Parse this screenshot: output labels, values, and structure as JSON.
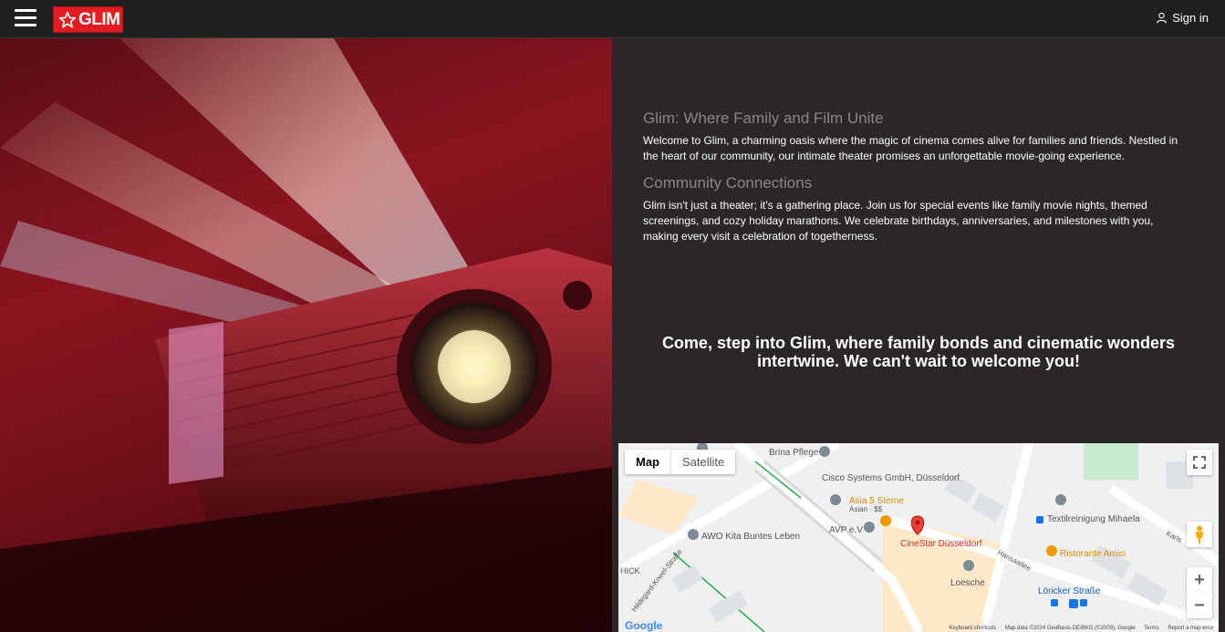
{
  "header": {
    "logo_text": "GLIM",
    "signin_label": "Sign in"
  },
  "content": {
    "section1_title": "Glim: Where Family and Film Unite",
    "section1_text": "Welcome to Glim, a charming oasis where the magic of cinema comes alive for families and friends. Nestled in the heart of our community, our intimate theater promises an unforgettable movie-going experience.",
    "section2_title": "Community Connections",
    "section2_text": "Glim isn't just a theater; it's a gathering place. Join us for special events like family movie nights, themed screenings, and cozy holiday marathons. We celebrate birthdays, anniversaries, and milestones with you, making every visit a celebration of togetherness.",
    "closing": "Come, step into Glim, where family bonds and cinematic wonders intertwine. We can't wait to welcome you!"
  },
  "map": {
    "type_map": "Map",
    "type_satellite": "Satellite",
    "places": {
      "brina": "Brina Pflege",
      "cisco": "Cisco Systems GmbH, Düsseldorf",
      "cisco2": "GmbH, Düsseldorf",
      "asia": "Asia 5 Sterne",
      "asia_sub": "Asian · $$",
      "awo": "AWO Kita Buntes Leben",
      "avp": "AVP e.V",
      "cinestar": "CineStar Düsseldorf",
      "textil": "Textilreinigung Mihaela",
      "ristorante": "Ristorante Amici",
      "loesche": "Loesche",
      "loricker": "Löricker Straße",
      "hansaallee": "Hansaallee",
      "hildegard": "Hildegard-Kneef-Straße",
      "hick": "HICK",
      "karls": "Karls"
    },
    "google": "Google",
    "footer": {
      "shortcuts": "Keyboard shortcuts",
      "mapdata": "Map data ©2024 GeoBasis-DE/BKG (©2009), Google",
      "terms": "Terms",
      "report": "Report a map error"
    },
    "colors": {
      "marker": "#ea4335",
      "poi": "#7b8a93",
      "food": "#f29900"
    }
  },
  "icons": {
    "menu": "hamburger-icon",
    "star": "star-icon",
    "user": "user-icon",
    "fullscreen": "fullscreen-icon",
    "pegman": "pegman-icon",
    "zoom_in": "plus-icon",
    "zoom_out": "minus-icon"
  }
}
